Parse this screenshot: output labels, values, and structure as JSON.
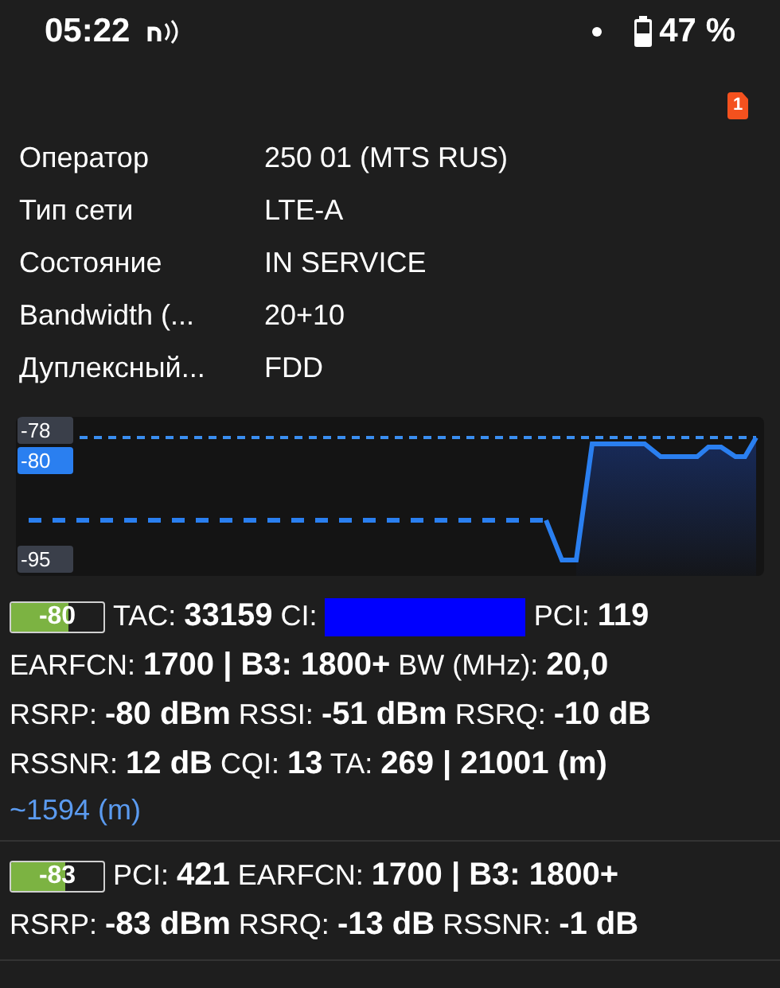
{
  "status_bar": {
    "time": "05:22",
    "battery": "47 %"
  },
  "sim_badge": "1",
  "info": [
    {
      "label": "Оператор",
      "value": "250 01 (MTS RUS)"
    },
    {
      "label": "Тип сети",
      "value": "LTE-A"
    },
    {
      "label": "Состояние",
      "value": "IN SERVICE"
    },
    {
      "label": "Bandwidth (...",
      "value": "20+10"
    },
    {
      "label": "Дуплексный...",
      "value": "FDD"
    }
  ],
  "graph": {
    "labels": [
      {
        "text": "-78",
        "selected": false
      },
      {
        "text": "-80",
        "selected": true
      },
      {
        "text": "-95",
        "selected": false
      }
    ]
  },
  "cells": [
    {
      "badge": "-80",
      "level": 0.62,
      "lines": [
        {
          "kind": "ci",
          "before": "TAC: **33159** CI:",
          "after": "PCI: **119**"
        },
        {
          "kind": "text",
          "text": "EARFCN: **1700 | B3: 1800+** BW (MHz): **20,0**"
        },
        {
          "kind": "text",
          "text": "RSRP: **-80 dBm** RSSI: **-51 dBm** RSRQ: **-10 dB**"
        },
        {
          "kind": "text",
          "text": "RSSNR: **12 dB** CQI: **13** TA: **269 | 21001 (m)**"
        },
        {
          "kind": "link",
          "text": "~1594 (m)"
        }
      ]
    },
    {
      "badge": "-83",
      "level": 0.58,
      "lines": [
        {
          "kind": "text",
          "text": "PCI: **421** EARFCN: **1700 | B3: 1800+**"
        },
        {
          "kind": "text",
          "text": "RSRP: **-83 dBm** RSRQ: **-13 dB** RSSNR: **-1 dB**"
        }
      ]
    }
  ]
}
